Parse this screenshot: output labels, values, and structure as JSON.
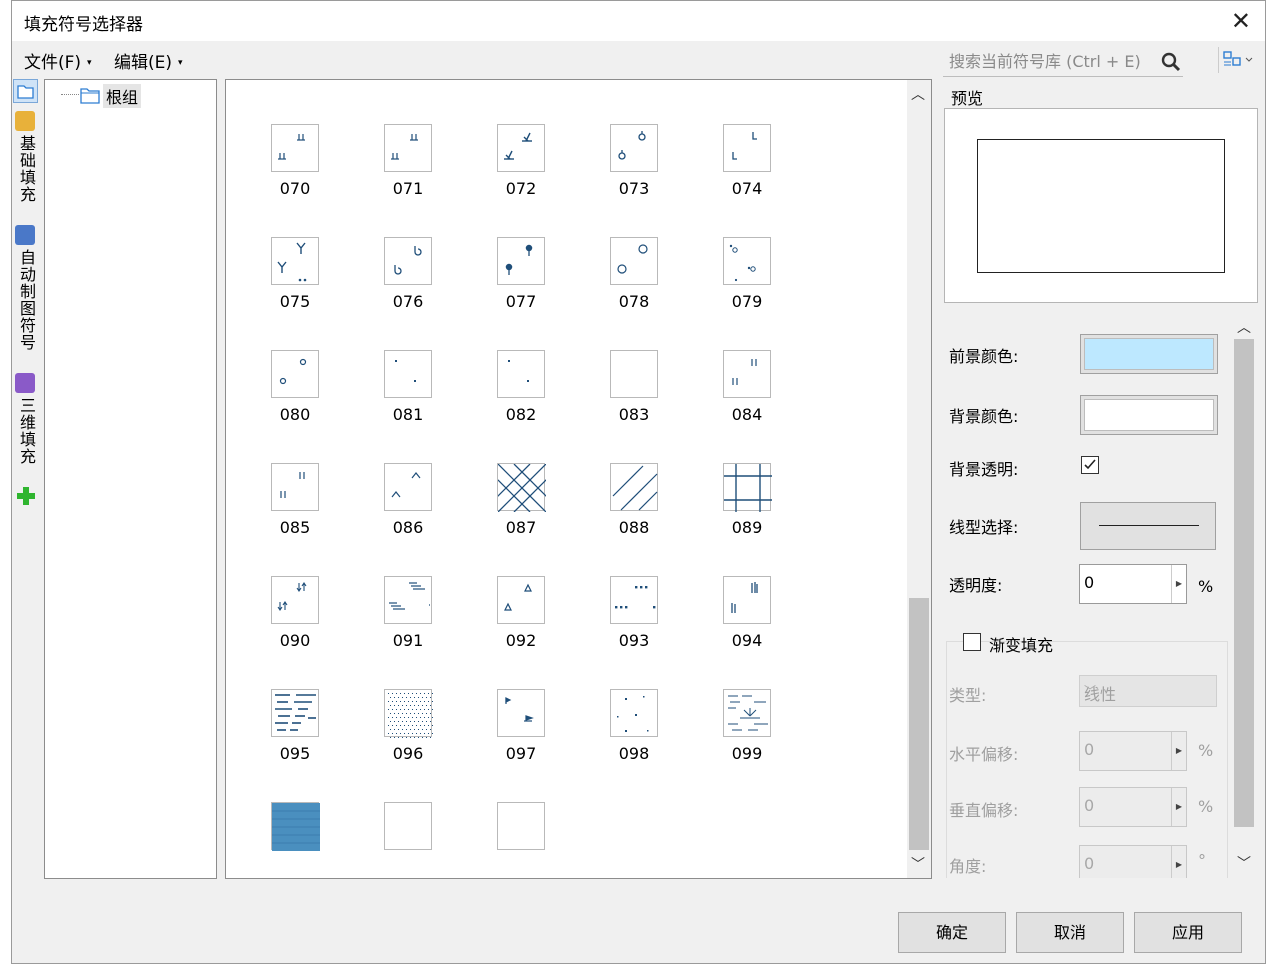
{
  "window": {
    "title": "填充符号选择器",
    "close_glyph": "✕"
  },
  "menu": [
    {
      "label": "文件(F)"
    },
    {
      "label": "编辑(E)"
    }
  ],
  "search": {
    "placeholder": "搜索当前符号库 (Ctrl + E)"
  },
  "sidebar_tabs": [
    {
      "label": "基础填充",
      "icon_color": "#e8b13a"
    },
    {
      "label": "自动制图符号",
      "icon_color": "#4a78c8"
    },
    {
      "label": "三维填充",
      "icon_color": "#8a5ac8"
    }
  ],
  "tree": {
    "root_label": "根组"
  },
  "symbols": [
    {
      "code": "070",
      "icon": "ticks-icon"
    },
    {
      "code": "071",
      "icon": "ticks-icon"
    },
    {
      "code": "072",
      "icon": "reed-icon"
    },
    {
      "code": "073",
      "icon": "bulb-icon"
    },
    {
      "code": "074",
      "icon": "l-mark-icon"
    },
    {
      "code": "075",
      "icon": "y-mark-icon"
    },
    {
      "code": "076",
      "icon": "hook-icon"
    },
    {
      "code": "077",
      "icon": "pin-icon"
    },
    {
      "code": "078",
      "icon": "circle-icon"
    },
    {
      "code": "079",
      "icon": "dot-circle-icon"
    },
    {
      "code": "080",
      "icon": "small-circle-icon"
    },
    {
      "code": "081",
      "icon": "dot-icon"
    },
    {
      "code": "082",
      "icon": "dot-icon"
    },
    {
      "code": "083",
      "icon": "blank-icon"
    },
    {
      "code": "084",
      "icon": "double-bar-icon"
    },
    {
      "code": "085",
      "icon": "double-bar-icon"
    },
    {
      "code": "086",
      "icon": "caret-icon"
    },
    {
      "code": "087",
      "icon": "crosshatch-icon"
    },
    {
      "code": "088",
      "icon": "diagonal-icon"
    },
    {
      "code": "089",
      "icon": "grid-icon"
    },
    {
      "code": "090",
      "icon": "arrows-icon"
    },
    {
      "code": "091",
      "icon": "dashes-icon"
    },
    {
      "code": "092",
      "icon": "triangle-icon"
    },
    {
      "code": "093",
      "icon": "dotted-row-icon"
    },
    {
      "code": "094",
      "icon": "bars-icon"
    },
    {
      "code": "095",
      "icon": "dense-dash-icon"
    },
    {
      "code": "096",
      "icon": "stipple-icon"
    },
    {
      "code": "097",
      "icon": "flag-icon"
    },
    {
      "code": "098",
      "icon": "scatter-icon"
    },
    {
      "code": "099",
      "icon": "marsh-icon"
    },
    {
      "code": "",
      "icon": "solid-fill-icon"
    },
    {
      "code": "",
      "icon": "blank-icon"
    },
    {
      "code": "",
      "icon": "blank-icon"
    }
  ],
  "preview": {
    "label": "预览"
  },
  "props": {
    "fg_label": "前景颜色:",
    "fg_color": "#bde8ff",
    "bg_label": "背景颜色:",
    "bg_color": "#ffffff",
    "transparent_label": "背景透明:",
    "transparent_checked": true,
    "linetype_label": "线型选择:",
    "opacity_label": "透明度:",
    "opacity_value": "0",
    "opacity_unit": "%",
    "gradient_label": "渐变填充",
    "gradient_checked": false,
    "type_label": "类型:",
    "type_value": "线性",
    "hoffset_label": "水平偏移:",
    "hoffset_value": "0",
    "hoffset_unit": "%",
    "voffset_label": "垂直偏移:",
    "voffset_value": "0",
    "voffset_unit": "%",
    "angle_label": "角度:",
    "angle_value": "0",
    "angle_unit": "°"
  },
  "buttons": {
    "ok": "确定",
    "cancel": "取消",
    "apply": "应用"
  },
  "colors": {
    "symbol_ink": "#1f4e79",
    "accent": "#2d7dd2"
  }
}
